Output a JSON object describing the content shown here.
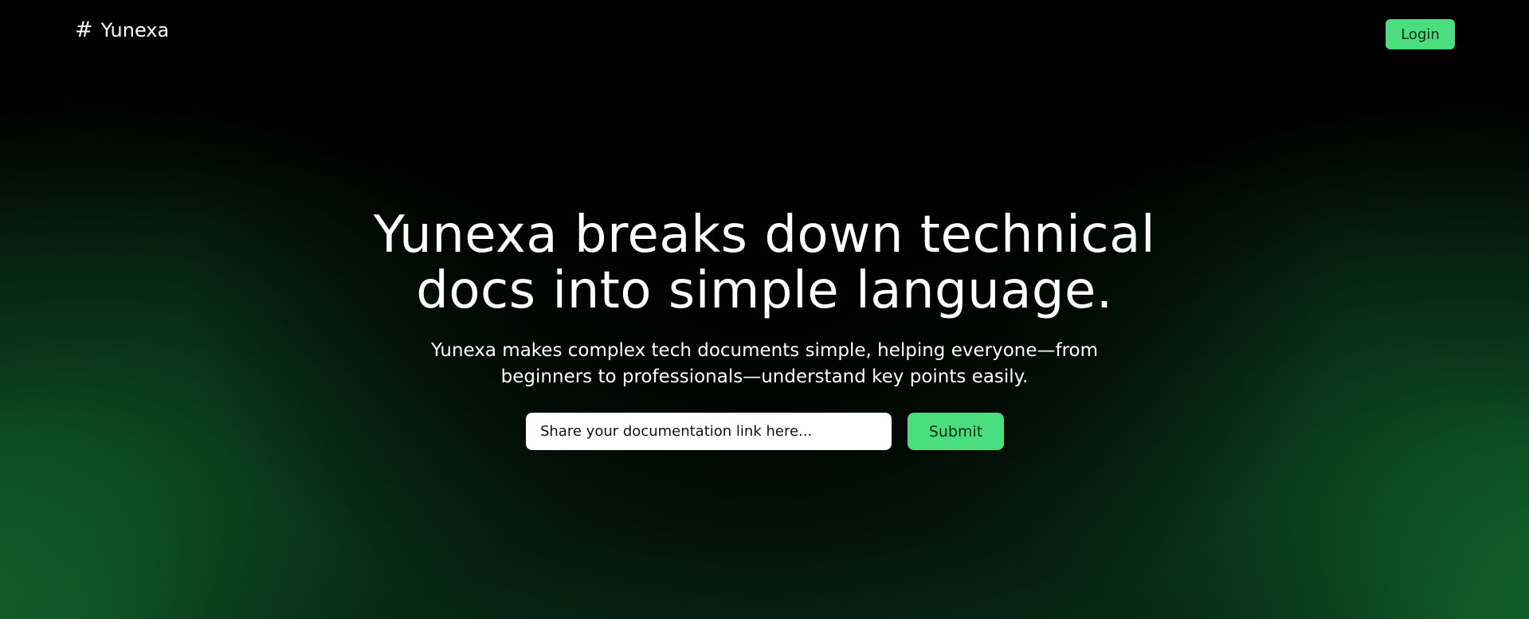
{
  "colors": {
    "background": "#000000",
    "accent": "#4ade80",
    "glow": "#16783a",
    "text": "#ffffff"
  },
  "nav": {
    "brand_icon": "#",
    "brand_name": "Yunexa",
    "login_label": "Login"
  },
  "hero": {
    "headline_line1": "Yunexa breaks down technical",
    "headline_line2": "docs into simple language.",
    "sub_line1": "Yunexa makes complex tech documents simple, helping everyone—from",
    "sub_line2": "beginners to professionals—understand key points easily."
  },
  "form": {
    "input_placeholder": "Share your documentation link here...",
    "submit_label": "Submit"
  },
  "icons": {
    "brand": "hash-icon"
  }
}
